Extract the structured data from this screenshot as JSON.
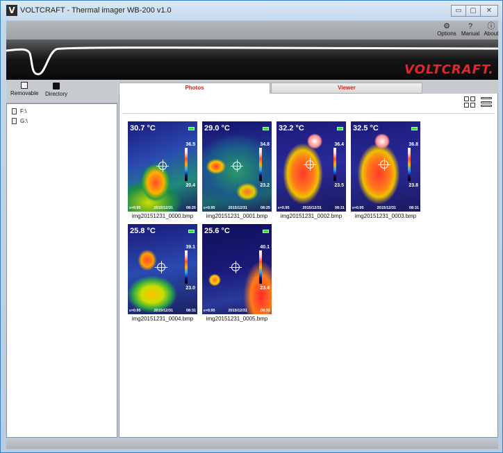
{
  "window": {
    "title": "VOLTCRAFT - Thermal imager WB-200 v1.0",
    "app_icon_letter": "V"
  },
  "toolbar": {
    "options_label": "Options",
    "manual_label": "Manual",
    "about_label": "About"
  },
  "banner": {
    "brand": "VOLTCRAFT."
  },
  "left": {
    "removable_label": "Removable",
    "directory_label": "Directory",
    "drives": [
      "F:\\",
      "G:\\"
    ]
  },
  "tabs": {
    "photos": "Photos",
    "viewer": "Viewer"
  },
  "thumbnails": [
    {
      "file": "img20151231_0000.bmp",
      "temp": "30.7 °C",
      "max": "36.5",
      "min": "20.4",
      "emissivity": "ε=0.95",
      "date": "2015/12/31",
      "time": "08:25"
    },
    {
      "file": "img20151231_0001.bmp",
      "temp": "29.0 °C",
      "max": "34.8",
      "min": "23.2",
      "emissivity": "ε=0.95",
      "date": "2015/12/31",
      "time": "08:25"
    },
    {
      "file": "img20151231_0002.bmp",
      "temp": "32.2 °C",
      "max": "36.4",
      "min": "23.5",
      "emissivity": "ε=0.95",
      "date": "2015/12/31",
      "time": "08:31"
    },
    {
      "file": "img20151231_0003.bmp",
      "temp": "32.5 °C",
      "max": "36.8",
      "min": "23.8",
      "emissivity": "ε=0.95",
      "date": "2015/12/31",
      "time": "08:31"
    },
    {
      "file": "img20151231_0004.bmp",
      "temp": "25.8 °C",
      "max": "39.1",
      "min": "23.0",
      "emissivity": "ε=0.95",
      "date": "2015/12/31",
      "time": "08:31"
    },
    {
      "file": "img20151231_0005.bmp",
      "temp": "25.6 °C",
      "max": "40.1",
      "min": "23.4",
      "emissivity": "ε=0.95",
      "date": "2015/12/31",
      "time": "08:32"
    }
  ],
  "icons": {
    "options": "gear-icon",
    "manual": "question-icon",
    "about": "info-icon",
    "removable": "sd-card-icon",
    "directory": "folder-icon",
    "grid_view": "grid-view-icon",
    "list_view": "list-view-icon"
  },
  "colors": {
    "brand_red": "#e3262b",
    "tab_red": "#d81e1e"
  }
}
